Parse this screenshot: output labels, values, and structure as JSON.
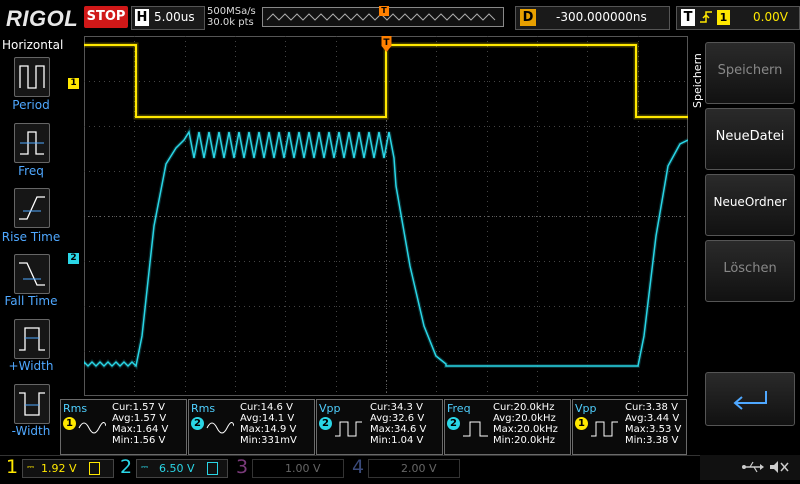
{
  "header": {
    "logo": "RIGOL",
    "run_state": "STOP",
    "horizontal_label": "H",
    "timebase": "5.00us",
    "sample_rate": "500MSa/s",
    "memory_depth": "30.0k pts",
    "trigger_marker": "T",
    "delay_label": "D",
    "delay": "-300.000000ns",
    "trigger_label": "T",
    "trigger_source": "1",
    "trigger_level": "0.00V"
  },
  "left_menu": {
    "title": "Horizontal",
    "items": [
      "Period",
      "Freq",
      "Rise Time",
      "Fall Time",
      "+Width",
      "-Width"
    ]
  },
  "channel_markers": {
    "ch1": "1",
    "ch2": "2"
  },
  "right_menu": {
    "title": "Speichern",
    "items": [
      "Speichern",
      "NeueDatei",
      "NeueOrdner",
      "Löschen"
    ]
  },
  "measurements": [
    {
      "type": "Rms",
      "ch": "1",
      "color": "#ffe800",
      "cur": "Cur:1.57 V",
      "avg": "Avg:1.57 V",
      "max": "Max:1.64 V",
      "min": "Min:1.56 V"
    },
    {
      "type": "Rms",
      "ch": "2",
      "color": "#2ad6e6",
      "cur": "Cur:14.6 V",
      "avg": "Avg:14.1 V",
      "max": "Max:14.9 V",
      "min": "Min:331mV"
    },
    {
      "type": "Vpp",
      "ch": "2",
      "color": "#2ad6e6",
      "cur": "Cur:34.3 V",
      "avg": "Avg:32.6 V",
      "max": "Max:34.6 V",
      "min": "Min:1.04 V"
    },
    {
      "type": "Freq",
      "ch": "2",
      "color": "#2ad6e6",
      "cur": "Cur:20.0kHz",
      "avg": "Avg:20.0kHz",
      "max": "Max:20.0kHz",
      "min": "Min:20.0kHz"
    },
    {
      "type": "Vpp",
      "ch": "1",
      "color": "#ffe800",
      "cur": "Cur:3.38 V",
      "avg": "Avg:3.44 V",
      "max": "Max:3.53 V",
      "min": "Min:3.38 V"
    }
  ],
  "channels": [
    {
      "num": "1",
      "scale": "1.92 V",
      "color": "#ffe800"
    },
    {
      "num": "2",
      "scale": "6.50 V",
      "color": "#2ad6e6"
    },
    {
      "num": "3",
      "scale": "1.00 V",
      "color": "#7a3a7a"
    },
    {
      "num": "4",
      "scale": "2.00 V",
      "color": "#3a4a7a"
    }
  ],
  "colors": {
    "ch1": "#ffe800",
    "ch2": "#2ad6e6",
    "stop": "#d01818",
    "accent": "#4fa8ff"
  }
}
